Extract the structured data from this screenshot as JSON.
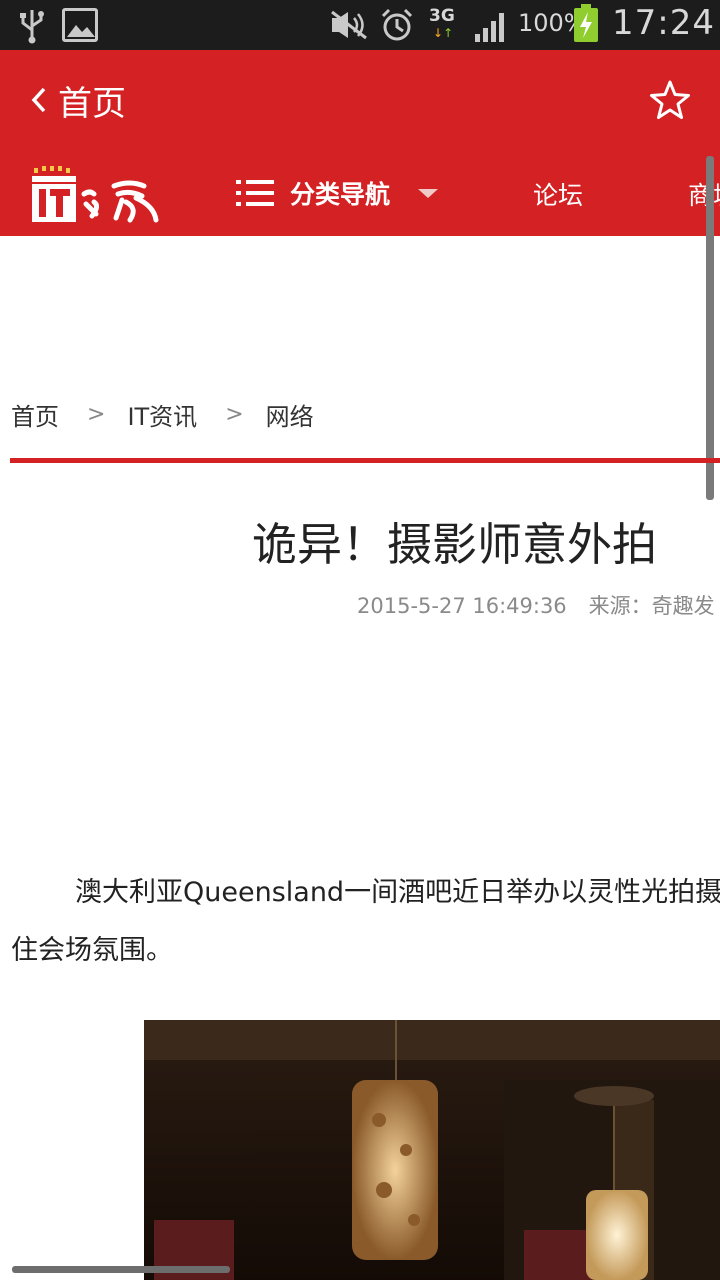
{
  "status_bar": {
    "network_type": "3G",
    "battery_percent": "100%",
    "time": "17:24",
    "icons": [
      "usb-icon",
      "gallery-icon",
      "mute-icon",
      "alarm-icon",
      "signal-icon",
      "battery-charging-icon"
    ]
  },
  "app_bar": {
    "back_label": "首页",
    "favorite_icon": "star-outline-icon"
  },
  "site_nav": {
    "logo_name": "IT之家",
    "category_label": "分类导航",
    "links": [
      "论坛",
      "商城"
    ]
  },
  "breadcrumb": {
    "items": [
      "首页",
      "IT资讯",
      "网络"
    ],
    "separator": ">"
  },
  "article": {
    "title": "诡异！摄影师意外拍",
    "date": "2015-5-27 16:49:36",
    "source": "来源：奇趣发",
    "paragraph": "澳大利亚Queensland一间酒吧近日举办以灵性光拍摄，想藉此捉住会场氛围。"
  },
  "colors": {
    "brand_red": "#d32124",
    "status_bar_bg": "#1c1c1c",
    "text": "#222222",
    "meta_text": "#8a8a8a"
  }
}
